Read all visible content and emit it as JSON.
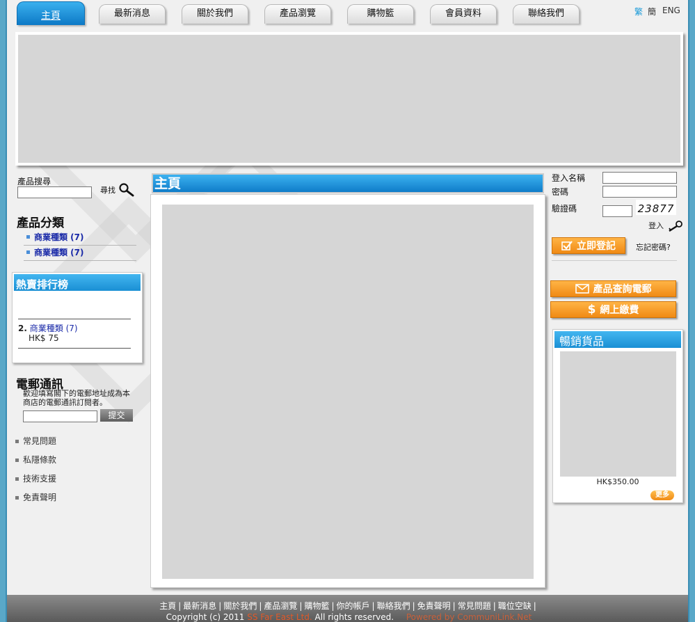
{
  "nav": {
    "tabs": [
      "主頁",
      "最新消息",
      "關於我們",
      "產品瀏覽",
      "購物籃",
      "會員資料",
      "聯絡我們"
    ],
    "active": 0,
    "lang": [
      "繁",
      "簡",
      "ENG"
    ]
  },
  "search": {
    "label": "產品搜尋",
    "button": "尋找"
  },
  "categories": {
    "title": "產品分類",
    "items": [
      "商業種類 (7)",
      "商業種類 (7)"
    ]
  },
  "bestsellers": {
    "title": "熱賣排行榜",
    "item_rank": "2.",
    "item_name": "商業種類 (7)",
    "item_price": "HK$ 75"
  },
  "newsletter": {
    "title": "電郵通訊",
    "desc": "歡迎填寫閣下的電郵地址成為本商店的電郵通訊訂閱者。",
    "submit": "提交"
  },
  "links": [
    "常見問題",
    "私隱條款",
    "技術支援",
    "免責聲明"
  ],
  "content": {
    "title": "主頁"
  },
  "login": {
    "username_label": "登入名稱",
    "password_label": "密碼",
    "captcha_label": "驗證碼",
    "captcha_code": "23877",
    "login": "登入",
    "register": "立即登記",
    "forgot": "忘記密碼?",
    "enquiry": "產品查詢電郵",
    "payment": "網上繳費"
  },
  "hot": {
    "title": "暢銷貨品",
    "price": "HK$350.00",
    "more": "更多"
  },
  "footer": {
    "links": [
      "主頁",
      "最新消息",
      "關於我們",
      "產品瀏覽",
      "購物籃",
      "你的帳戶",
      "聯絡我們",
      "免責聲明",
      "常見問題",
      "職位空缺"
    ],
    "copyright": "Copyright (c) 2011",
    "company": "SS Far East Ltd.",
    "rights": "All rights reserved.",
    "powered": "Powered by CommuniLink.Net"
  }
}
